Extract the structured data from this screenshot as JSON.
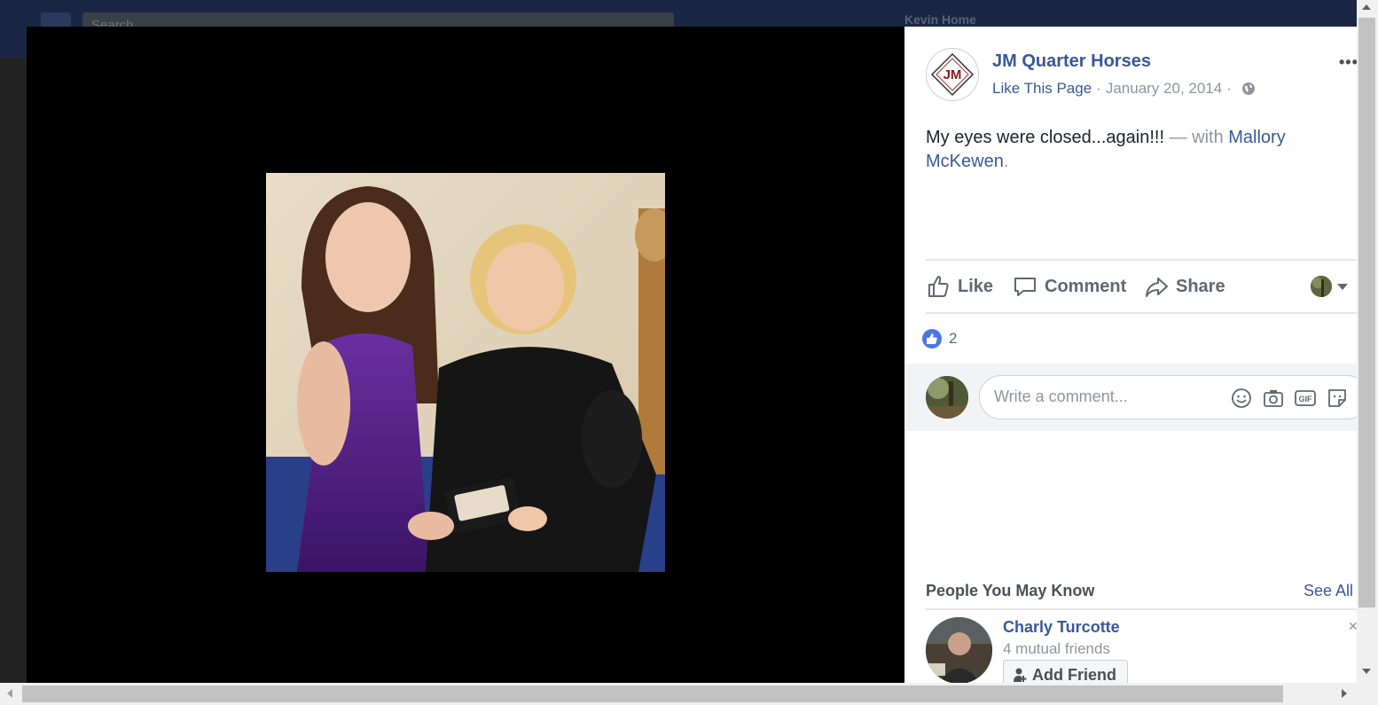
{
  "background": {
    "search_placeholder": "Search",
    "user_name": "Kevin    Home"
  },
  "post": {
    "page_name": "JM Quarter Horses",
    "like_page_label": "Like This Page",
    "date": "January 20, 2014",
    "separator": "·",
    "more_label": "•••",
    "text": "My eyes were closed...again!!!",
    "with_text": " — with ",
    "tagged_person": "Mallory McKewen",
    "tag_period": ".",
    "logo_text": "JM"
  },
  "actions": {
    "like_label": "Like",
    "comment_label": "Comment",
    "share_label": "Share"
  },
  "reactions": {
    "count": "2"
  },
  "comment": {
    "placeholder": "Write a comment...",
    "gif_label": "GIF"
  },
  "people_you_may_know": {
    "title": "People You May Know",
    "see_all_label": "See All",
    "people": [
      {
        "name": "Charly Turcotte",
        "mutual": "4 mutual friends",
        "add_friend_label": "Add Friend"
      }
    ]
  },
  "colors": {
    "link": "#385898",
    "muted": "#90949c",
    "like_blue": "#4a76e8",
    "topbar": "#1a2744"
  },
  "icons": [
    "globe-icon",
    "more-icon",
    "like-icon",
    "comment-icon",
    "share-icon",
    "caret-down-icon",
    "emoji-icon",
    "camera-icon",
    "gif-icon",
    "sticker-icon",
    "add-friend-icon",
    "close-icon"
  ]
}
